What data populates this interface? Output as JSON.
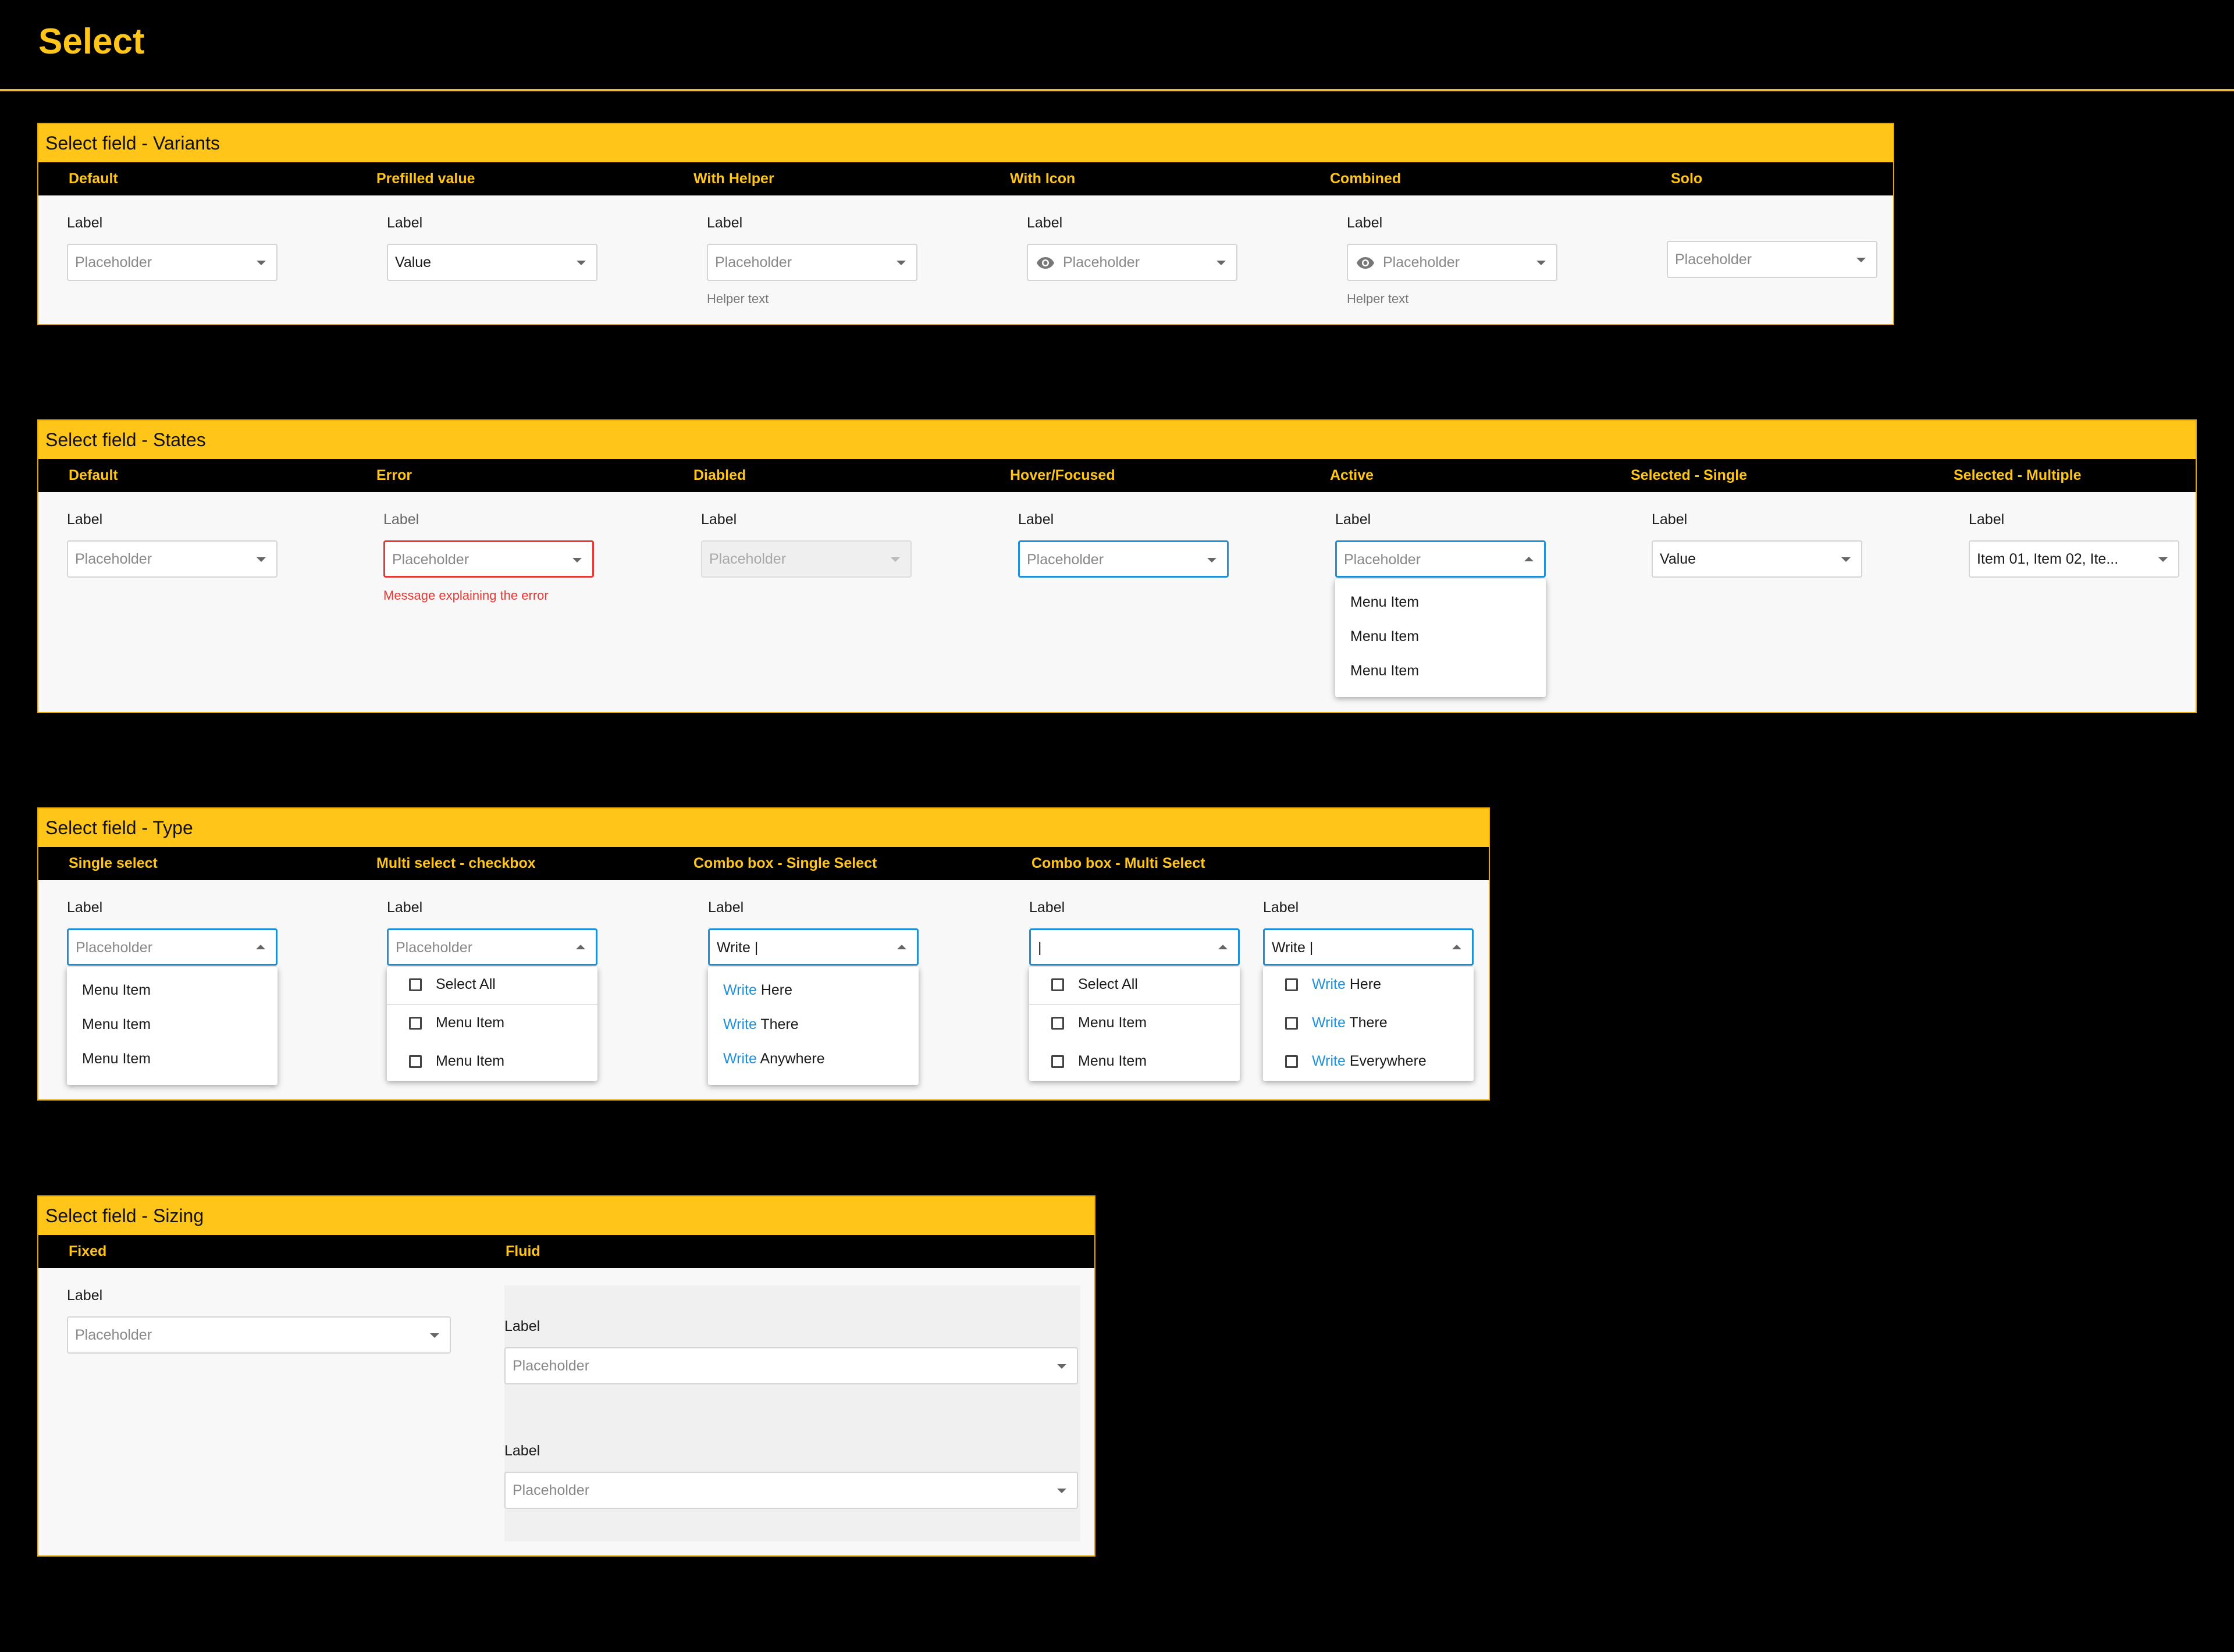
{
  "page": {
    "title": "Select"
  },
  "variants": {
    "title": "Select field - Variants",
    "columns": [
      "Default",
      "Prefilled value",
      "With Helper",
      "With Icon",
      "Combined",
      "Solo"
    ],
    "label": "Label",
    "placeholder": "Placeholder",
    "prefilled_value": "Value",
    "helper_text": "Helper text"
  },
  "states": {
    "title": "Select field - States",
    "columns": [
      "Default",
      "Error",
      "Diabled",
      "Hover/Focused",
      "Active",
      "Selected - Single",
      "Selected - Multiple"
    ],
    "label": "Label",
    "placeholder": "Placeholder",
    "error_message": "Message explaining the error",
    "selected_single_value": "Value",
    "selected_multiple_value": "Item 01, Item 02, Ite...",
    "active_menu": [
      "Menu Item",
      "Menu Item",
      "Menu Item"
    ]
  },
  "type": {
    "title": "Select field - Type",
    "columns": [
      "Single select",
      "Multi select - checkbox",
      "Combo box - Single Select",
      "Combo box - Multi Select"
    ],
    "label": "Label",
    "placeholder": "Placeholder",
    "single_menu": [
      "Menu Item",
      "Menu Item",
      "Menu Item"
    ],
    "multi_menu": {
      "select_all": "Select All",
      "items": [
        "Menu Item",
        "Menu Item"
      ]
    },
    "combo_single": {
      "input_value": "Write |",
      "options": [
        {
          "match": "Write",
          "rest": " Here"
        },
        {
          "match": "Write",
          "rest": " There"
        },
        {
          "match": "Write",
          "rest": " Anywhere"
        }
      ]
    },
    "combo_multi_empty": {
      "input_value": "|",
      "select_all": "Select All",
      "items": [
        "Menu Item",
        "Menu Item"
      ]
    },
    "combo_multi_typed": {
      "input_value": "Write |",
      "options": [
        {
          "match": "Write",
          "rest": " Here"
        },
        {
          "match": "Write",
          "rest": " There"
        },
        {
          "match": "Write",
          "rest": " Everywhere"
        }
      ]
    }
  },
  "sizing": {
    "title": "Select field - Sizing",
    "columns": [
      "Fixed",
      "Fluid"
    ],
    "label": "Label",
    "placeholder": "Placeholder"
  },
  "colors": {
    "accent": "#ffc519",
    "focus": "#1f8fd8",
    "error": "#e53935",
    "background": "#000000",
    "panel": "#f8f8f8"
  },
  "icons": {
    "dropdown": "caret-down-icon",
    "visibility": "eye-icon",
    "checkbox": "checkbox-icon"
  }
}
